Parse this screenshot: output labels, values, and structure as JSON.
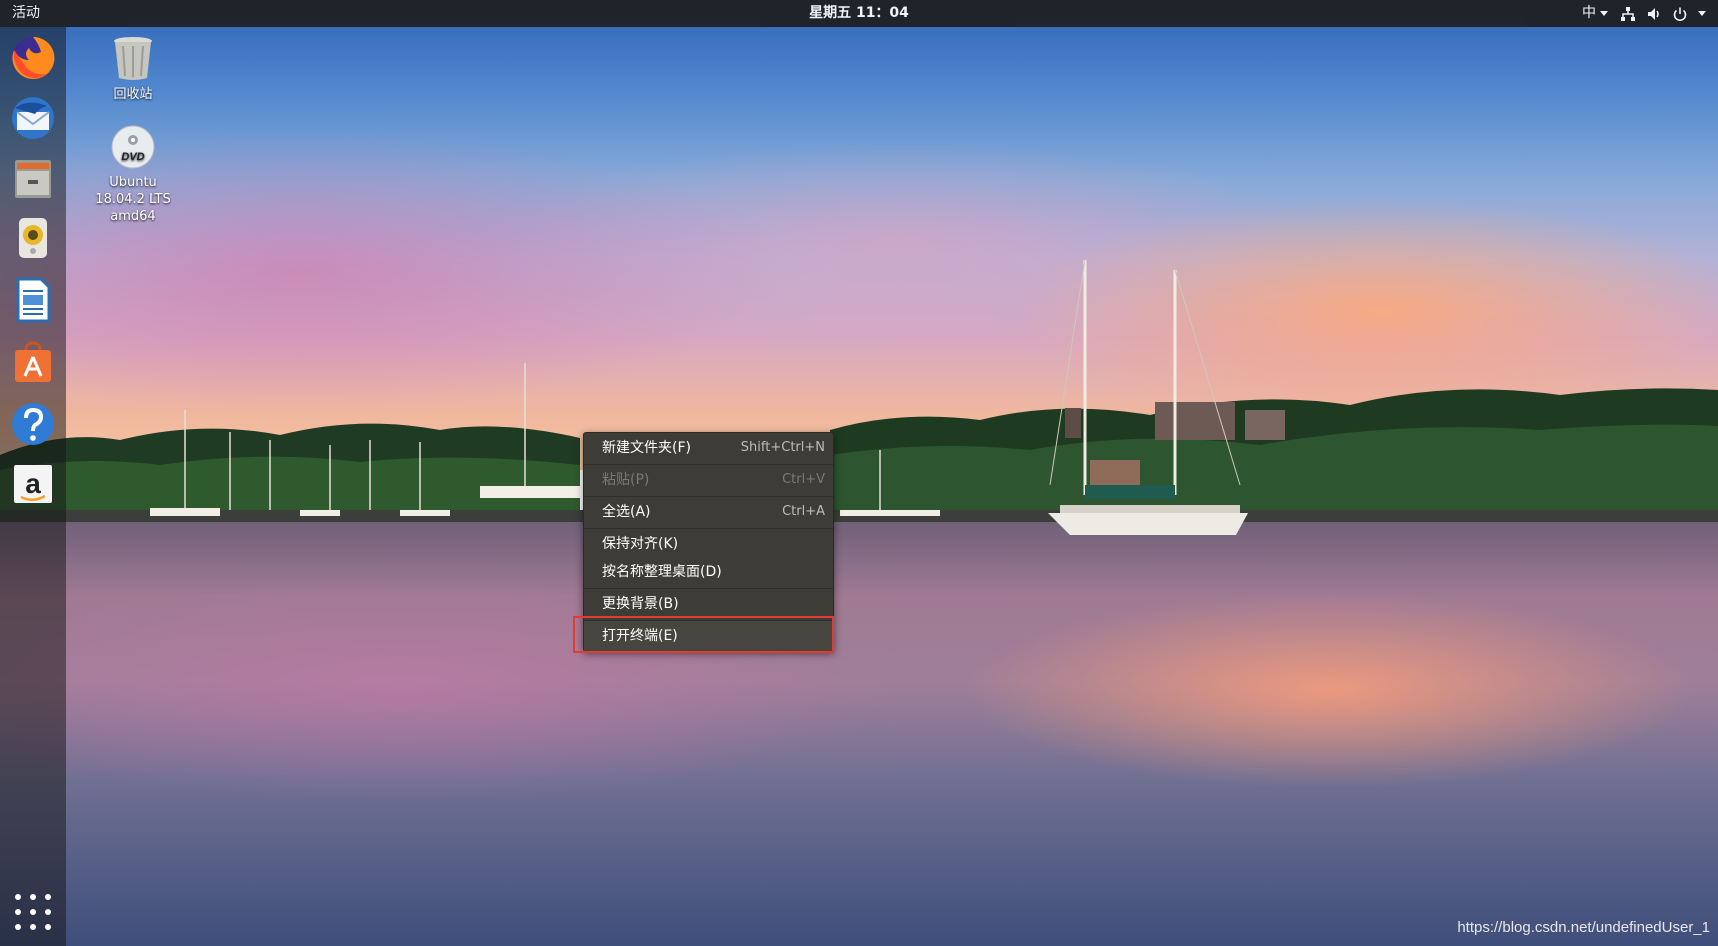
{
  "topbar": {
    "activities": "活动",
    "clock": "星期五 11：04",
    "input_method": "中"
  },
  "dock": {
    "items": [
      {
        "name": "firefox"
      },
      {
        "name": "thunderbird"
      },
      {
        "name": "files"
      },
      {
        "name": "rhythmbox"
      },
      {
        "name": "libreoffice-writer"
      },
      {
        "name": "ubuntu-software"
      },
      {
        "name": "help"
      },
      {
        "name": "amazon"
      }
    ],
    "amazon_glyph": "a"
  },
  "desktop": {
    "trash_label": "回收站",
    "dvd_label_line1": "Ubuntu",
    "dvd_label_line2": "18.04.2 LTS",
    "dvd_label_line3": "amd64",
    "dvd_disc_text": "DVD"
  },
  "context_menu": {
    "items": [
      {
        "label": "新建文件夹(F)",
        "accel": "Shift+Ctrl+N",
        "enabled": true
      },
      {
        "label": "粘贴(P)",
        "accel": "Ctrl+V",
        "enabled": false
      },
      {
        "label": "全选(A)",
        "accel": "Ctrl+A",
        "enabled": true
      },
      {
        "label": "保持对齐(K)",
        "accel": "",
        "enabled": true
      },
      {
        "label": "按名称整理桌面(D)",
        "accel": "",
        "enabled": true
      },
      {
        "label": "更换背景(B)",
        "accel": "",
        "enabled": true
      },
      {
        "label": "打开终端(E)",
        "accel": "",
        "enabled": true,
        "highlighted": true
      }
    ]
  },
  "watermark": "https://blog.csdn.net/undefinedUser_1",
  "colors": {
    "topbar": "#1f1f1f",
    "menu_bg": "#3d3c37",
    "highlight_box": "#e23b30"
  }
}
